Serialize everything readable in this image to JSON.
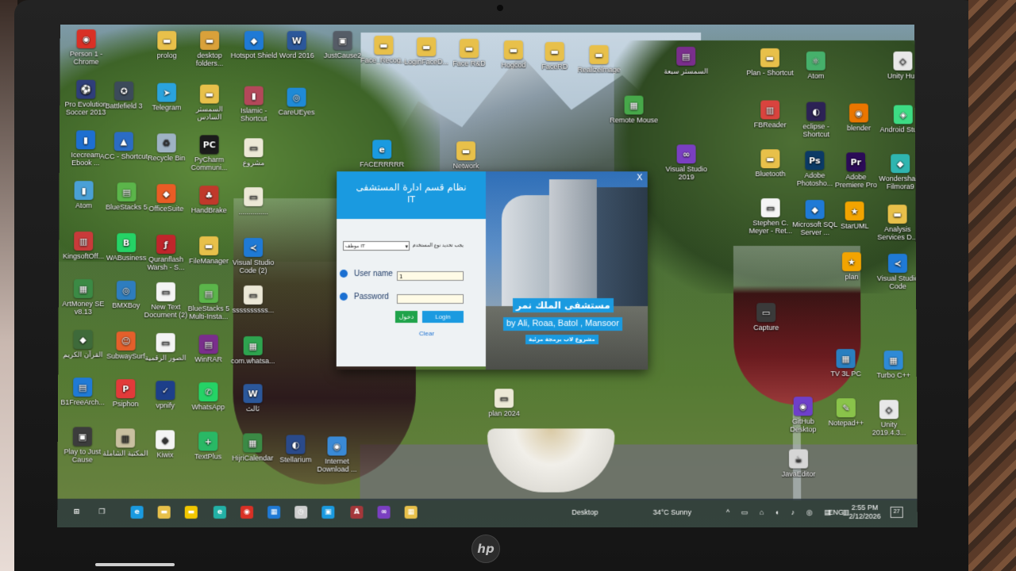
{
  "desktop_icons": [
    {
      "label": "Person 1 - Chrome",
      "icon": "chrome-icon",
      "color": "#d93025",
      "glyph": "◉"
    },
    {
      "label": "prolog",
      "icon": "folder-icon",
      "color": "#e8c04a",
      "glyph": "▬"
    },
    {
      "label": "desktop folders...",
      "icon": "folder-shortcut-icon",
      "color": "#d9a13a",
      "glyph": "▬"
    },
    {
      "label": "Hotspot Shield",
      "icon": "hotspot-shield-icon",
      "color": "#1f7ad6",
      "glyph": "◆"
    },
    {
      "label": "Word 2016",
      "icon": "word-icon",
      "color": "#2b579a",
      "glyph": "W"
    },
    {
      "label": "JustCause2",
      "icon": "game-icon",
      "color": "#555c66",
      "glyph": "▣"
    },
    {
      "label": "Face_Recog...",
      "icon": "folder-icon",
      "color": "#e8c04a",
      "glyph": "▬"
    },
    {
      "label": "LoginFaceD...",
      "icon": "folder-icon",
      "color": "#e8c04a",
      "glyph": "▬"
    },
    {
      "label": "Face R&D",
      "icon": "folder-icon",
      "color": "#e8c04a",
      "glyph": "▬"
    },
    {
      "label": "Hogcod",
      "icon": "folder-icon",
      "color": "#e8c04a",
      "glyph": "▬"
    },
    {
      "label": "FaceRD",
      "icon": "folder-icon",
      "color": "#e8c04a",
      "glyph": "▬"
    },
    {
      "label": "Realizelmage",
      "icon": "folder-icon",
      "color": "#e8c04a",
      "glyph": "▬"
    },
    {
      "label": "السمستر سبعة",
      "icon": "winrar-icon",
      "color": "#7a2e8c",
      "glyph": "▤"
    },
    {
      "label": "Plan - Shortcut",
      "icon": "folder-shortcut-icon",
      "color": "#e8c04a",
      "glyph": "▬"
    },
    {
      "label": "Atom",
      "icon": "atom-icon",
      "color": "#46b06b",
      "glyph": "⚛"
    },
    {
      "label": "Unity Hub",
      "icon": "unity-icon",
      "color": "#e8e8e8",
      "glyph": "◇"
    },
    {
      "label": "Pro Evolution Soccer 2013",
      "icon": "pes-icon",
      "color": "#2f3e7a",
      "glyph": "⚽"
    },
    {
      "label": "Battlefield 3",
      "icon": "battlefield-icon",
      "color": "#3c4a5a",
      "glyph": "✪"
    },
    {
      "label": "Telegram",
      "icon": "telegram-icon",
      "color": "#2aa3dd",
      "glyph": "➤"
    },
    {
      "label": "السمستر السادس",
      "icon": "folder-icon",
      "color": "#e8c04a",
      "glyph": "▬"
    },
    {
      "label": "Islamic - Shortcut",
      "icon": "book-icon",
      "color": "#b3485a",
      "glyph": "▮"
    },
    {
      "label": "CareUEyes",
      "icon": "eye-icon",
      "color": "#1f8ad6",
      "glyph": "◎"
    },
    {
      "label": "Remote Mouse",
      "icon": "remote-mouse-icon",
      "color": "#47a84a",
      "glyph": "▦"
    },
    {
      "label": "FBReader",
      "icon": "fbreader-icon",
      "color": "#d9433e",
      "glyph": "▥"
    },
    {
      "label": "eclipse - Shortcut",
      "icon": "eclipse-icon",
      "color": "#2c2255",
      "glyph": "◐"
    },
    {
      "label": "blender",
      "icon": "blender-icon",
      "color": "#ea7600",
      "glyph": "◉"
    },
    {
      "label": "Android Studio",
      "icon": "android-studio-icon",
      "color": "#3ddc84",
      "glyph": "◈"
    },
    {
      "label": "Icecream Ebook ...",
      "icon": "ebook-icon",
      "color": "#1d6fd1",
      "glyph": "▮"
    },
    {
      "label": "ACC - Shortcut",
      "icon": "acc-icon",
      "color": "#2b6cc4",
      "glyph": "▲"
    },
    {
      "label": "Recycle Bin",
      "icon": "recycle-bin-icon",
      "color": "#9fb3c4",
      "glyph": "♻"
    },
    {
      "label": "PyCharm Communi...",
      "icon": "pycharm-icon",
      "color": "#1b1b1b",
      "glyph": "PC"
    },
    {
      "label": "مشروع",
      "icon": "file-icon",
      "color": "#ece8d6",
      "glyph": "▭"
    },
    {
      "label": "FACERRRRR",
      "icon": "edge-shortcut-icon",
      "color": "#1a9ae0",
      "glyph": "e"
    },
    {
      "label": "Network",
      "icon": "network-icon",
      "color": "#e8c04a",
      "glyph": "▬"
    },
    {
      "label": "Visual Studio 2019",
      "icon": "visual-studio-icon",
      "color": "#7a3fc1",
      "glyph": "∞"
    },
    {
      "label": "Bluetooth",
      "icon": "bluetooth-icon",
      "color": "#e8c04a",
      "glyph": "▬"
    },
    {
      "label": "Adobe Photosho...",
      "icon": "photoshop-icon",
      "color": "#0b3a66",
      "glyph": "Ps"
    },
    {
      "label": "Adobe Premiere Pro",
      "icon": "premiere-icon",
      "color": "#2b0b57",
      "glyph": "Pr"
    },
    {
      "label": "Wondershare Filmora9",
      "icon": "filmora-icon",
      "color": "#2fb5b0",
      "glyph": "◆"
    },
    {
      "label": "Atom",
      "icon": "atom-shortcut-icon",
      "color": "#4aa0d6",
      "glyph": "▮"
    },
    {
      "label": "BlueStacks 5",
      "icon": "bluestacks-icon",
      "color": "#5bb54a",
      "glyph": "▤"
    },
    {
      "label": "OfficeSuite",
      "icon": "officesuite-icon",
      "color": "#e95c25",
      "glyph": "◆"
    },
    {
      "label": "HandBrake",
      "icon": "handbrake-icon",
      "color": "#c0392b",
      "glyph": "♣"
    },
    {
      "label": "...............",
      "icon": "file-icon",
      "color": "#ece8d6",
      "glyph": "▭"
    },
    {
      "label": "Stephen C. Meyer - Ret...",
      "icon": "pdf-icon",
      "color": "#f4f4f4",
      "glyph": "▭"
    },
    {
      "label": "Microsoft SQL Server ...",
      "icon": "sql-server-icon",
      "color": "#1f7ad6",
      "glyph": "◆"
    },
    {
      "label": "StarUML",
      "icon": "staruml-icon",
      "color": "#f2a400",
      "glyph": "★"
    },
    {
      "label": "Analysis Services D...",
      "icon": "analysis-services-icon",
      "color": "#e8c04a",
      "glyph": "▬"
    },
    {
      "label": "KingsoftOff...",
      "icon": "kingsoft-icon",
      "color": "#c93a3a",
      "glyph": "▥"
    },
    {
      "label": "WABusiness",
      "icon": "whatsapp-business-icon",
      "color": "#25d366",
      "glyph": "B"
    },
    {
      "label": "Quranflash Warsh - S...",
      "icon": "flash-icon",
      "color": "#c0252b",
      "glyph": "ƒ"
    },
    {
      "label": "FileManager",
      "icon": "folder-icon",
      "color": "#e8c04a",
      "glyph": "▬"
    },
    {
      "label": "Visual Studio Code (2)",
      "icon": "vscode-icon",
      "color": "#1f7ad6",
      "glyph": "≺"
    },
    {
      "label": "plan",
      "icon": "star-icon",
      "color": "#f2a400",
      "glyph": "★"
    },
    {
      "label": "Visual Studio Code",
      "icon": "vscode-icon",
      "color": "#1f7ad6",
      "glyph": "≺"
    },
    {
      "label": "ArtMoney SE v8.13",
      "icon": "artmoney-icon",
      "color": "#3b8a45",
      "glyph": "▦"
    },
    {
      "label": "BMXBoy",
      "icon": "bmx-icon",
      "color": "#2e7dbf",
      "glyph": "◎"
    },
    {
      "label": "New Text Document (2)",
      "icon": "text-file-icon",
      "color": "#f4f4f4",
      "glyph": "▭"
    },
    {
      "label": "BlueStacks 5 Multi-Insta...",
      "icon": "bluestacks-icon",
      "color": "#5bb54a",
      "glyph": "▤"
    },
    {
      "label": "ssssssssss...",
      "icon": "file-icon",
      "color": "#ece8d6",
      "glyph": "▭"
    },
    {
      "label": "Capture",
      "icon": "image-file-icon",
      "color": "#3a3a3a",
      "glyph": "▭"
    },
    {
      "label": "القرآن الكريم",
      "icon": "quran-icon",
      "color": "#3e6a3a",
      "glyph": "◆"
    },
    {
      "label": "SubwaySurf",
      "icon": "subway-surf-icon",
      "color": "#e45f2b",
      "glyph": "☺"
    },
    {
      "label": "الصور الرقمية",
      "icon": "document-icon",
      "color": "#f4f4f4",
      "glyph": "▭"
    },
    {
      "label": "WinRAR",
      "icon": "winrar-icon",
      "color": "#7a2e8c",
      "glyph": "▤"
    },
    {
      "label": "com.whatsa...",
      "icon": "archive-icon",
      "color": "#2ea44f",
      "glyph": "▦"
    },
    {
      "label": "TV 3L PC",
      "icon": "tv-icon",
      "color": "#2a7fc0",
      "glyph": "▦"
    },
    {
      "label": "Turbo C++",
      "icon": "turbo-cpp-icon",
      "color": "#2e8ad6",
      "glyph": "▦"
    },
    {
      "label": "B1FreeArch...",
      "icon": "b1-archiver-icon",
      "color": "#1f7ad6",
      "glyph": "▤"
    },
    {
      "label": "Psiphon",
      "icon": "psiphon-icon",
      "color": "#e23a3a",
      "glyph": "P"
    },
    {
      "label": "vpnify",
      "icon": "vpnify-icon",
      "color": "#1d3f8a",
      "glyph": "✓"
    },
    {
      "label": "WhatsApp",
      "icon": "whatsapp-icon",
      "color": "#25d366",
      "glyph": "✆"
    },
    {
      "label": "ثالث",
      "icon": "word-doc-icon",
      "color": "#2b579a",
      "glyph": "W"
    },
    {
      "label": "plan 2024",
      "icon": "file-icon",
      "color": "#ece8d6",
      "glyph": "▭"
    },
    {
      "label": "GitHub Desktop",
      "icon": "github-desktop-icon",
      "color": "#6e40c9",
      "glyph": "◉"
    },
    {
      "label": "Notepad++",
      "icon": "notepadpp-icon",
      "color": "#8ac34a",
      "glyph": "✎"
    },
    {
      "label": "Unity 2019.4.3...",
      "icon": "unity-icon",
      "color": "#e8e8e8",
      "glyph": "◇"
    },
    {
      "label": "Play to Just Cause",
      "icon": "just-cause-icon",
      "color": "#3c3c3c",
      "glyph": "▣"
    },
    {
      "label": "المكتبة الشاملة",
      "icon": "library-icon",
      "color": "#c9c0a0",
      "glyph": "▥"
    },
    {
      "label": "Kiwix",
      "icon": "kiwix-icon",
      "color": "#f4f4f4",
      "glyph": "◆"
    },
    {
      "label": "TextPlus",
      "icon": "textplus-icon",
      "color": "#29b865",
      "glyph": "+"
    },
    {
      "label": "HijriCalendar",
      "icon": "calendar-icon",
      "color": "#3b8a45",
      "glyph": "▦"
    },
    {
      "label": "Stellarium",
      "icon": "stellarium-icon",
      "color": "#2a4a8a",
      "glyph": "◐"
    },
    {
      "label": "Internet Download ...",
      "icon": "idm-icon",
      "color": "#3a8ad6",
      "glyph": "◉"
    },
    {
      "label": "JavaEditor",
      "icon": "java-editor-icon",
      "color": "#d6d6d6",
      "glyph": "☕"
    }
  ],
  "login_dialog": {
    "title": "نظام قسم ادارة المستشفى",
    "subtitle": "IT",
    "role_prompt": "يجب تحديد نوع المستخدم",
    "role_selected": "موظف IT",
    "username_label": "User name",
    "username_value": "1",
    "password_label": "Password",
    "password_value": "",
    "green_button_label": "دخول",
    "login_button_label": "Login",
    "clear_link": "Clear",
    "close_glyph": "X",
    "hospital_name": "مستشفى الملك نمر",
    "credits": "by Ali, Roaa, Batol , Mansoor",
    "project_tag": "مشروع لاب برمجة مرئية"
  },
  "taskbar": {
    "pinned": [
      {
        "icon": "windows-start-icon",
        "glyph": "⊞",
        "color": "#ffffff"
      },
      {
        "icon": "task-view-icon",
        "glyph": "❐",
        "color": "#ffffff"
      },
      {
        "icon": "edge-icon",
        "glyph": "e",
        "color": "#1a9ae0"
      },
      {
        "icon": "file-explorer-icon",
        "glyph": "▬",
        "color": "#e8c04a"
      },
      {
        "icon": "sticky-notes-icon",
        "glyph": "▬",
        "color": "#f2c700"
      },
      {
        "icon": "edge-dev-icon",
        "glyph": "e",
        "color": "#22b1a6"
      },
      {
        "icon": "chrome-icon",
        "glyph": "◉",
        "color": "#d93025"
      },
      {
        "icon": "store-icon",
        "glyph": "▦",
        "color": "#1f7ad6"
      },
      {
        "icon": "clock-app-icon",
        "glyph": "◷",
        "color": "#cfcfcf"
      },
      {
        "icon": "photos-icon",
        "glyph": "▣",
        "color": "#1a9ae0"
      },
      {
        "icon": "access-icon",
        "glyph": "A",
        "color": "#a4373a"
      },
      {
        "icon": "visual-studio-icon",
        "glyph": "∞",
        "color": "#7a3fc1"
      },
      {
        "icon": "app-icon",
        "glyph": "▦",
        "color": "#e8c04a"
      }
    ],
    "desktop_label": "Desktop",
    "weather": "34°C  Sunny",
    "tray_icons": "^ ▭ ⌂ ◐ ♪ ◎ ▤ ▥",
    "language": "ENG",
    "time": "2:55 PM",
    "date": "2/12/2026",
    "notification_count": "27"
  },
  "laptop": {
    "brand": "hp"
  }
}
